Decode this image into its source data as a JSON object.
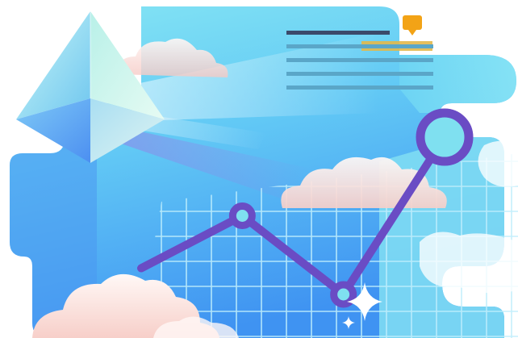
{
  "illustration": {
    "subject": "growth-analytics-hero",
    "icons": [
      "crystal-pyramid-icon",
      "document-lines-icon",
      "comment-flag-icon",
      "trend-line-chart-icon",
      "sparkle-icon",
      "cloud-icon"
    ]
  },
  "colors": {
    "sky_light": "#7fe3f3",
    "sky_mid": "#5fc6f5",
    "sky_deep": "#3f95f3",
    "doc_heading": "#3b4a6b",
    "doc_line": "#5aa6c8",
    "highlight": "#e2b84a",
    "flag": "#f3a316",
    "trend_line": "#6a4cc4",
    "trend_node_fill": "#7fe0f0",
    "grid": "#bfeefc",
    "cloud_white": "#fff6f4",
    "cloud_pink": "#f9d2cc",
    "sparkle": "#ffffff"
  },
  "chart_data": {
    "type": "line",
    "x": [
      1,
      2,
      3,
      4
    ],
    "values": [
      3,
      5,
      2,
      8
    ],
    "markers": [
      false,
      true,
      true,
      true
    ],
    "grid": true,
    "title": "",
    "xlabel": "",
    "ylabel": ""
  }
}
